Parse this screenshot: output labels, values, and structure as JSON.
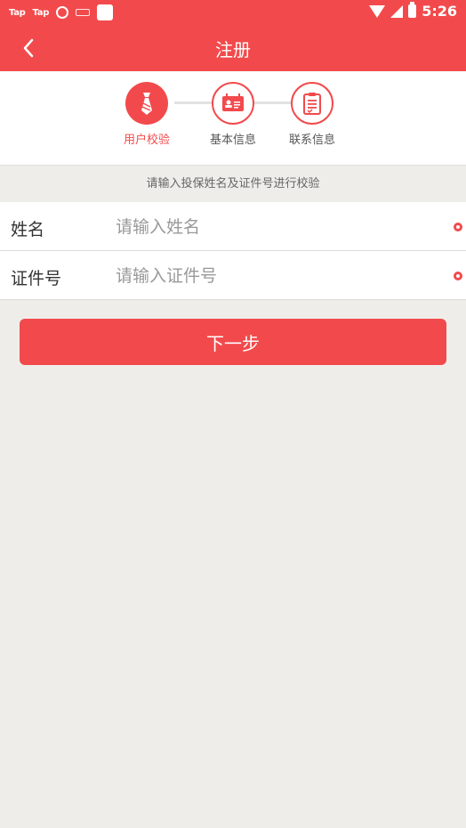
{
  "status_bar": {
    "left_items": [
      "Tap",
      "Tap"
    ],
    "time": "5:26",
    "icons": [
      "sync-icon",
      "keyboard-icon",
      "app-square-icon",
      "wifi-icon",
      "signal-icon",
      "battery-icon"
    ]
  },
  "header": {
    "title": "注册",
    "back_icon": "chevron-left-icon"
  },
  "steps": [
    {
      "label": "用户校验",
      "active": true,
      "icon": "tie-icon"
    },
    {
      "label": "基本信息",
      "active": false,
      "icon": "id-card-icon"
    },
    {
      "label": "联系信息",
      "active": false,
      "icon": "clipboard-icon"
    }
  ],
  "hint": "请输入投保姓名及证件号进行校验",
  "form": {
    "name": {
      "label": "姓名",
      "placeholder": "请输入姓名",
      "value": ""
    },
    "id_number": {
      "label": "证件号",
      "placeholder": "请输入证件号",
      "value": ""
    }
  },
  "next_button": "下一步",
  "colors": {
    "accent": "#f24a4c",
    "background": "#efedea"
  }
}
